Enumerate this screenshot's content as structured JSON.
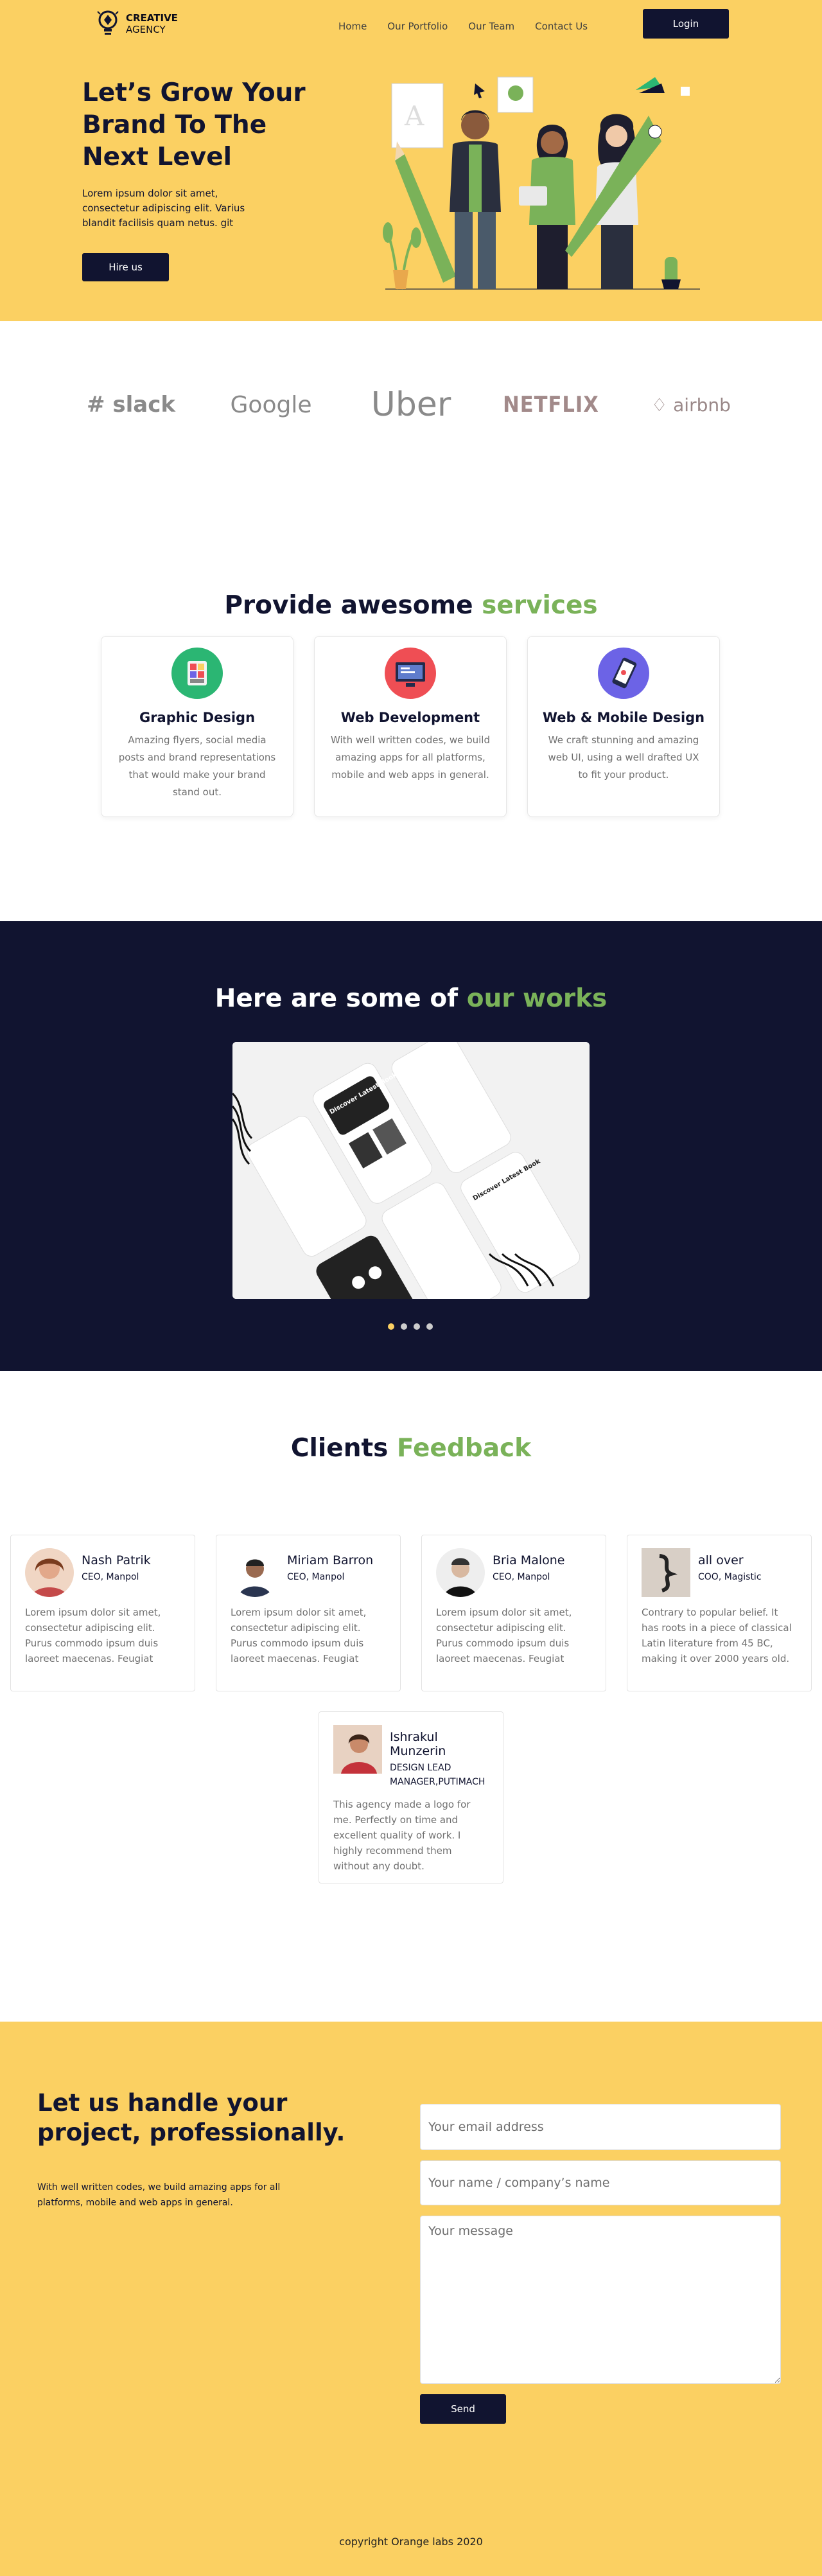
{
  "header": {
    "logo": {
      "line1": "CREATIVE",
      "line2": "AGENCY"
    },
    "nav": [
      "Home",
      "Our Portfolio",
      "Our Team",
      "Contact Us"
    ],
    "login_label": "Login",
    "title": "Let’s Grow Your Brand To The Next Level",
    "text": "Lorem ipsum dolor sit amet, consectetur adipiscing elit. Varius blandit facilisis quam netus. git",
    "hire_label": "Hire us"
  },
  "brands": [
    "slack",
    "Google",
    "Uber",
    "NETFLIX",
    "airbnb"
  ],
  "services": {
    "title_plain": "Provide awesome",
    "title_highlight": "services",
    "items": [
      {
        "name": "Graphic Design",
        "desc": "Amazing flyers, social media posts and brand representations that would make your brand stand out.",
        "icon": "graphic-design-icon",
        "color": "#2bb673"
      },
      {
        "name": "Web Development",
        "desc": "With well written codes, we build amazing apps for all platforms, mobile and web apps in general.",
        "icon": "web-development-icon",
        "color": "#ef4e54"
      },
      {
        "name": "Web & Mobile Design",
        "desc": "We craft stunning and amazing web UI, using a well drafted UX to fit your product.",
        "icon": "mobile-design-icon",
        "color": "#6c63e6"
      }
    ]
  },
  "works": {
    "title_plain": "Here are some of",
    "title_highlight": "our works",
    "slide_texts": [
      "Discover Latest Book",
      "Discover Latest Book"
    ],
    "dots": 4,
    "active_dot": 0
  },
  "feedback": {
    "title_plain": "Clients",
    "title_highlight": "Feedback",
    "items": [
      {
        "name": "Nash Patrik",
        "role": "CEO, Manpol",
        "text": "Lorem ipsum dolor sit amet, consectetur adipiscing elit. Purus commodo ipsum duis laoreet maecenas. Feugiat"
      },
      {
        "name": "Miriam Barron",
        "role": "CEO, Manpol",
        "text": "Lorem ipsum dolor sit amet, consectetur adipiscing elit. Purus commodo ipsum duis laoreet maecenas. Feugiat"
      },
      {
        "name": "Bria Malone",
        "role": "CEO, Manpol",
        "text": "Lorem ipsum dolor sit amet, consectetur adipiscing elit. Purus commodo ipsum duis laoreet maecenas. Feugiat"
      },
      {
        "name": "all over",
        "role": "COO, Magistic",
        "text": "Contrary to popular belief. It has roots in a piece of classical Latin literature from 45 BC, making it over 2000 years old."
      },
      {
        "name": "Ishrakul Munzerin",
        "role": "DESIGN LEAD MANAGER,PUTIMACH",
        "text": "This agency made a logo for me. Perfectly on time and excellent quality of work. I highly recommend them without any doubt."
      }
    ]
  },
  "contact": {
    "title": "Let us handle your project, professionally.",
    "text": "With well written codes, we build amazing apps for all platforms, mobile and web apps in general.",
    "email_placeholder": "Your email address",
    "name_placeholder": "Your name / company’s name",
    "message_placeholder": "Your message",
    "send_label": "Send",
    "copyright": "copyright Orange labs 2020"
  },
  "colors": {
    "yellow": "#fbd062",
    "navy": "#111430",
    "green": "#7ab259"
  }
}
